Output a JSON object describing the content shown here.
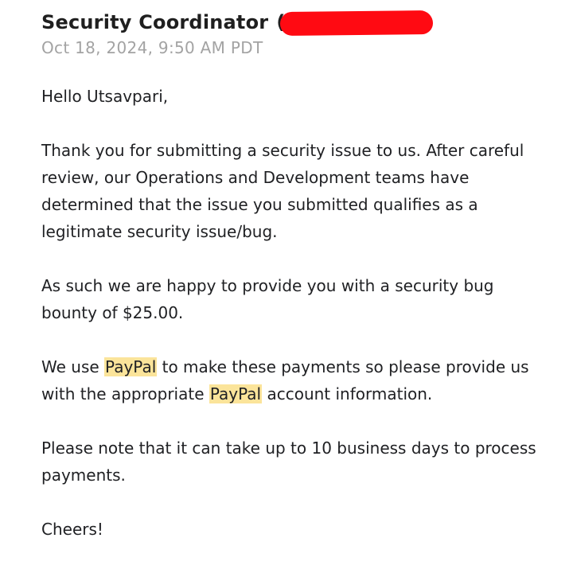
{
  "email": {
    "sender_name": "Security Coordinator",
    "sender_paren": "(",
    "timestamp": "Oct 18, 2024, 9:50 AM PDT",
    "greeting": "Hello Utsavpari,",
    "paragraph1": "Thank you for submitting a security issue to us. After careful review, our Operations and Development teams have determined that the issue you submitted qualifies as a legitimate security issue/bug.",
    "paragraph2": "As such we are happy to provide you with a security bug bounty of $25.00.",
    "paragraph3": {
      "part1": "We use ",
      "highlight1": "PayPal",
      "part2": " to make these payments so please provide us with the appropriate ",
      "highlight2": "PayPal",
      "part3": " account information."
    },
    "paragraph4": "Please note that it can take up to 10 business days to process payments.",
    "signoff": "Cheers!"
  },
  "colors": {
    "redaction": "#ff0a12",
    "highlight": "#fbe49a",
    "timestamp": "#a3a3a3"
  }
}
